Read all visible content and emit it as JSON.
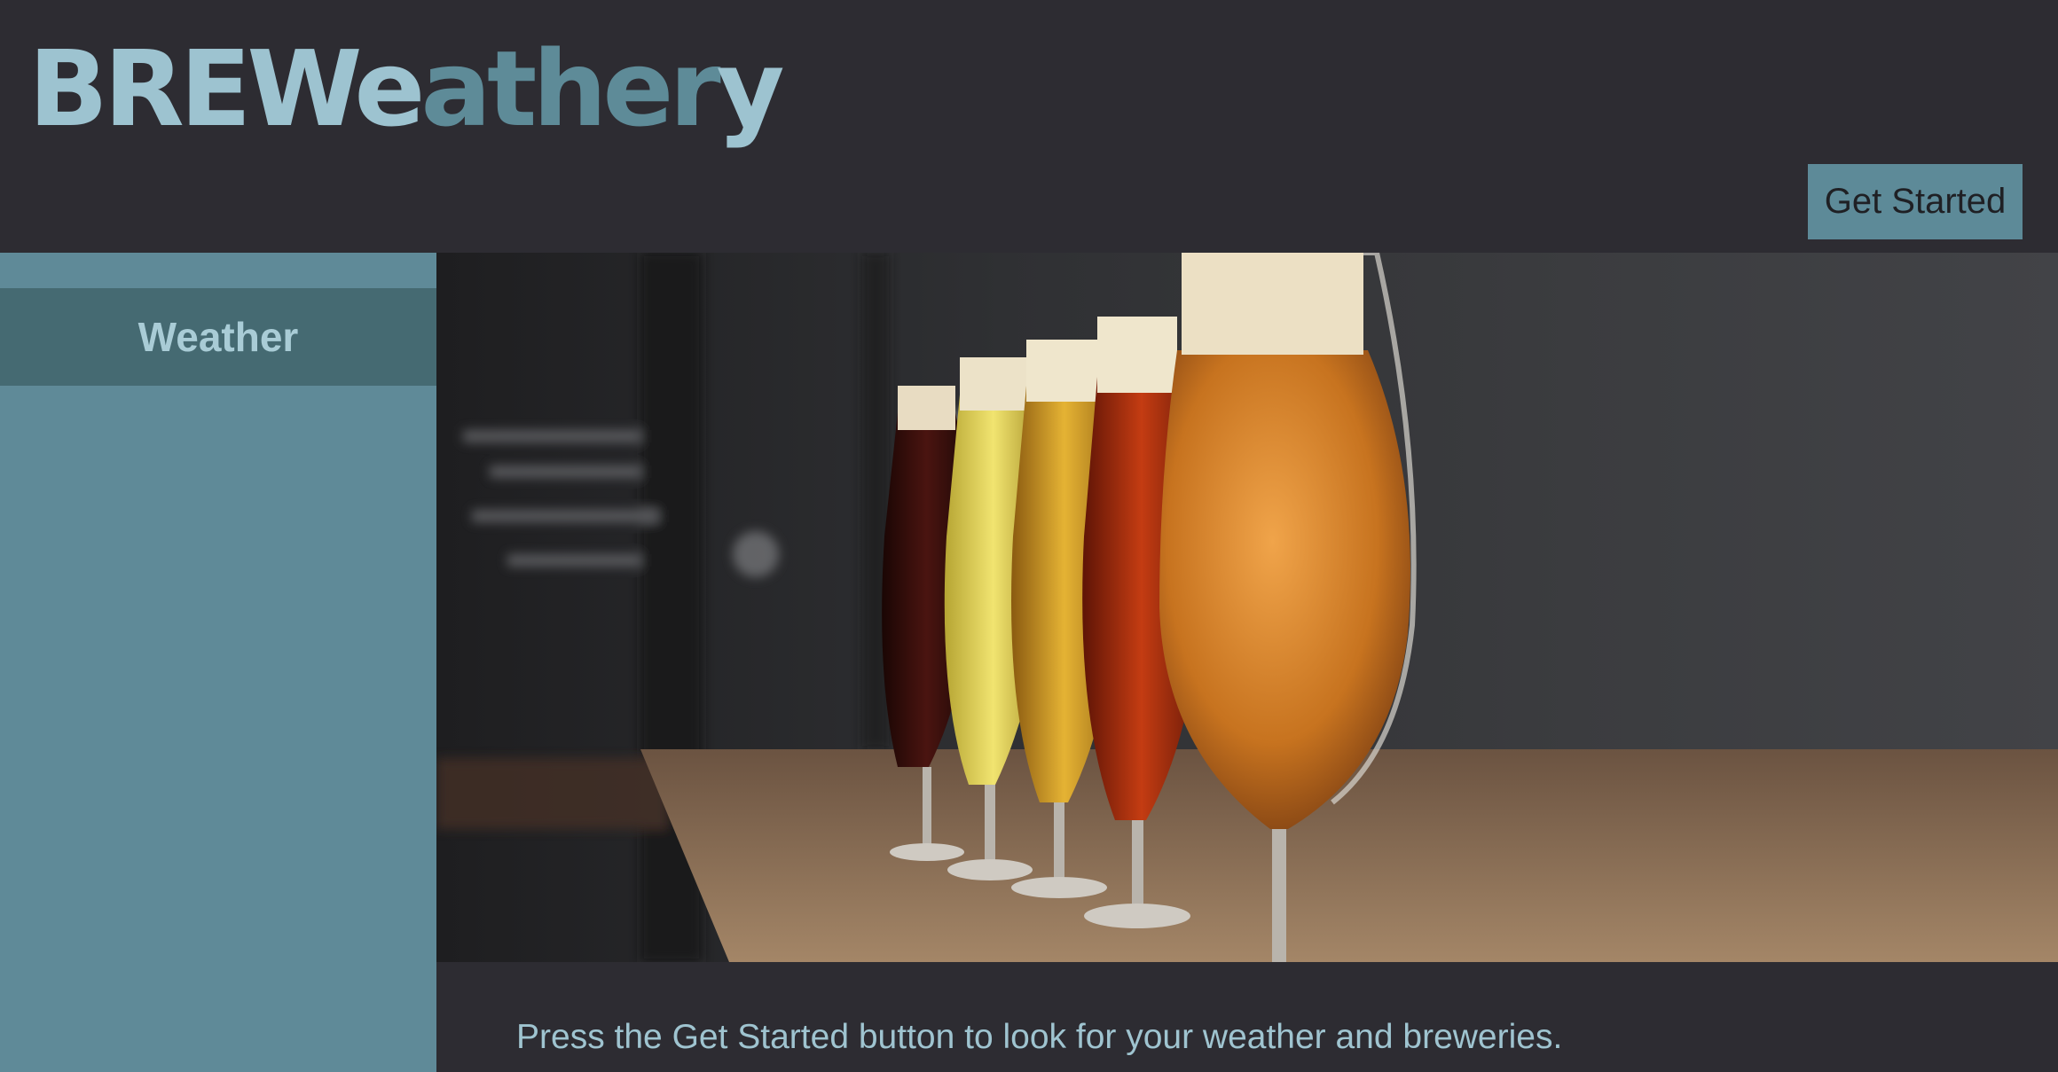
{
  "header": {
    "logo_part1": "BREWe",
    "logo_part2": "ather",
    "logo_part3": "y",
    "get_started_label": "Get Started"
  },
  "sidebar": {
    "items": [
      {
        "label": "Weather"
      }
    ]
  },
  "main": {
    "hero_image": "beer-glasses-on-bar-photo",
    "caption": "Press the Get Started button to look for your weather and breweries."
  },
  "colors": {
    "background": "#2d2c32",
    "accent": "#5f8a98",
    "accent_light": "#9dc3d0",
    "sidebar_active": "#456a72"
  }
}
